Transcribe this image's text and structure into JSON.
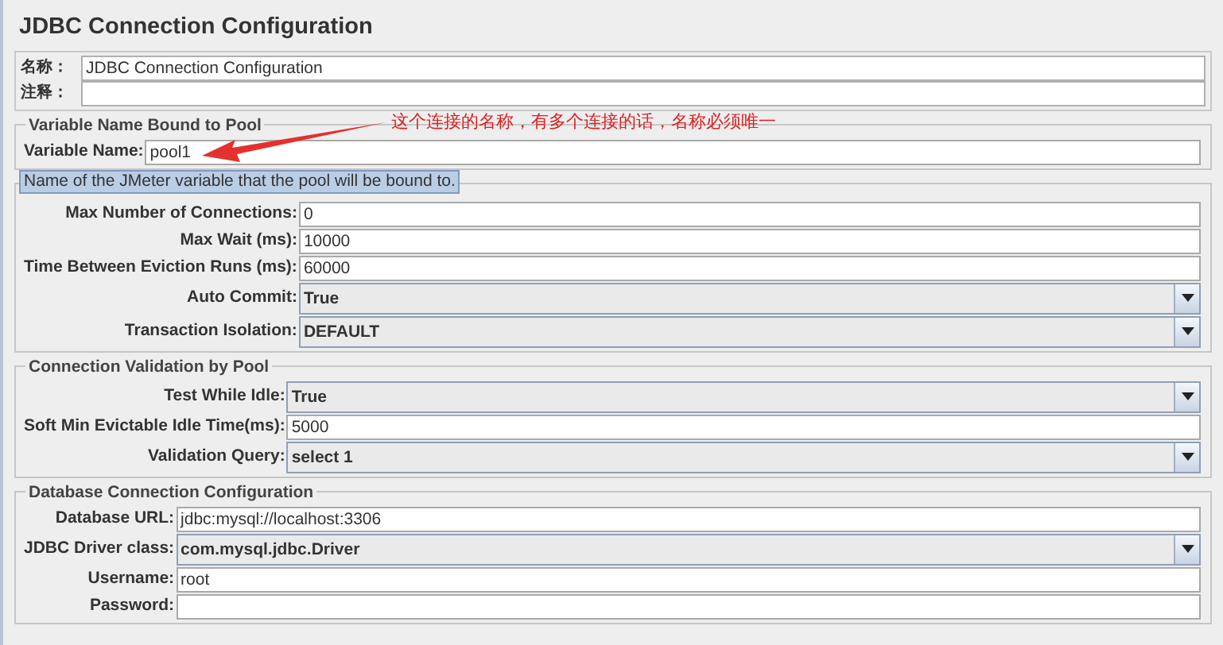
{
  "title": "JDBC Connection Configuration",
  "header_fields": [
    {
      "label": "名称：",
      "value": "JDBC Connection Configuration"
    },
    {
      "label": "注释："
    }
  ],
  "annotation": {
    "text": "这个连接的名称，有多个连接的话，名称必须唯一"
  },
  "tooltip": {
    "text": "Name of the JMeter variable that the pool will be bound to."
  },
  "groups": [
    {
      "legend": "Variable Name Bound to Pool",
      "fields": [
        {
          "kind": "text",
          "label": "Variable Name:",
          "value": "pool1"
        }
      ]
    },
    {
      "fields": [
        {
          "kind": "text",
          "label": "Max Number of Connections:",
          "value": "0"
        },
        {
          "kind": "text",
          "label": "Max Wait (ms):",
          "value": "10000"
        },
        {
          "kind": "text",
          "label": "Time Between Eviction Runs (ms):",
          "value": "60000"
        },
        {
          "kind": "combo",
          "label": "Auto Commit:",
          "value": "True"
        },
        {
          "kind": "combo",
          "label": "Transaction Isolation:",
          "value": "DEFAULT"
        }
      ]
    },
    {
      "legend": "Connection Validation by Pool",
      "fields": [
        {
          "kind": "combo",
          "label": "Test While Idle:",
          "value": "True"
        },
        {
          "kind": "text",
          "label": "Soft Min Evictable Idle Time(ms):",
          "value": "5000"
        },
        {
          "kind": "combo",
          "label": "Validation Query:",
          "value": "select 1"
        }
      ]
    },
    {
      "legend": "Database Connection Configuration",
      "fields": [
        {
          "kind": "text",
          "label": "Database URL:",
          "value": "jdbc:mysql://localhost:3306"
        },
        {
          "kind": "combo",
          "label": "JDBC Driver class:",
          "value": "com.mysql.jdbc.Driver"
        },
        {
          "kind": "text",
          "label": "Username:",
          "value": "root"
        },
        {
          "kind": "text",
          "label": "Password:"
        }
      ]
    }
  ]
}
